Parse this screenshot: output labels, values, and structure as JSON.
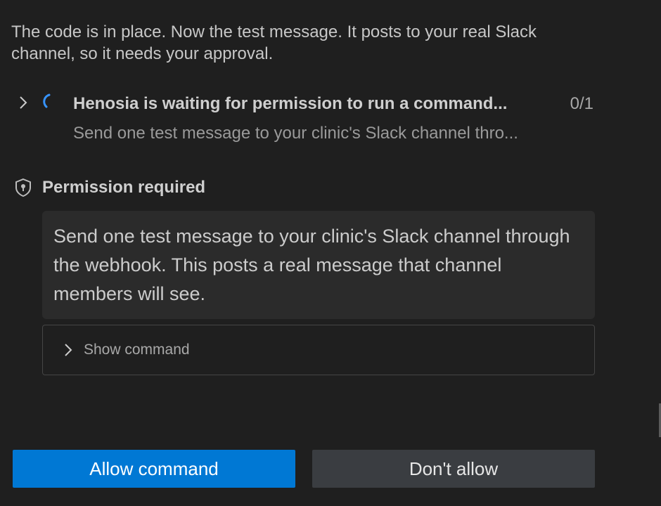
{
  "intro": {
    "text_line1": "The code is in place. Now the test message. It posts to your real Slack",
    "text_line2": "channel, so it needs your approval."
  },
  "task": {
    "chevron_icon": "chevron-right-icon",
    "spinner_icon": "spinner-icon",
    "title": "Henosia is waiting for permission to run a command...",
    "count": "0/1",
    "subtitle": "Send one test message to your clinic's Slack channel thro..."
  },
  "permission": {
    "icon": "shield-icon",
    "title": "Permission required",
    "description": "Send one test message to your clinic's Slack channel through the webhook. This posts a real message that channel members will see.",
    "show_command_label": "Show command",
    "show_command_icon": "chevron-right-icon"
  },
  "actions": {
    "allow_label": "Allow command",
    "deny_label": "Don't allow"
  },
  "colors": {
    "background": "#1f1f1f",
    "accent": "#0078d4",
    "spinner": "#3794ff",
    "secondary_button": "#3a3d41"
  }
}
